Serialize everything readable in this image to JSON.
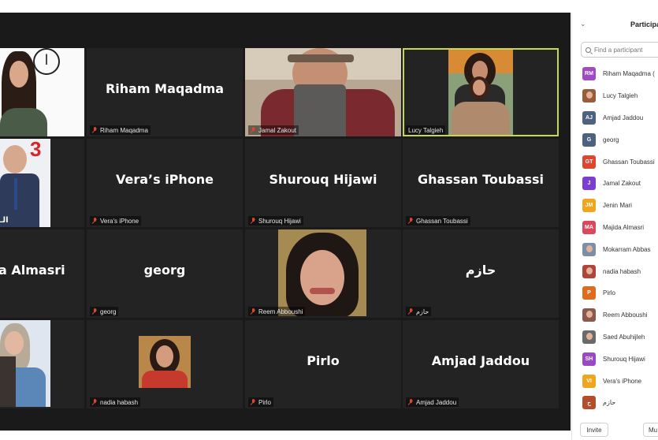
{
  "video_tiles": [
    {
      "name": "",
      "label": "",
      "type": "photo"
    },
    {
      "name": "Riham Maqadma",
      "label": "Riham Maqadma",
      "type": "name"
    },
    {
      "name": "",
      "label": "Jamal Zakout",
      "type": "photo"
    },
    {
      "name": "",
      "label": "Lucy Talgieh",
      "type": "photo",
      "active": true
    },
    {
      "name": "",
      "label": "",
      "type": "photo"
    },
    {
      "name": "Vera’s iPhone",
      "label": "Vera's iPhone",
      "type": "name"
    },
    {
      "name": "Shurouq Hijawi",
      "label": "Shurouq Hijawi",
      "type": "name"
    },
    {
      "name": "Ghassan Toubassi",
      "label": "Ghassan Toubassi",
      "type": "name"
    },
    {
      "name": "a Almasri",
      "label": "",
      "type": "name"
    },
    {
      "name": "georg",
      "label": "georg",
      "type": "name"
    },
    {
      "name": "",
      "label": "Reem Abboushi",
      "type": "photo"
    },
    {
      "name": "حازم",
      "label": "حازم",
      "type": "name"
    },
    {
      "name": "",
      "label": "",
      "type": "photo"
    },
    {
      "name": "",
      "label": "nadia habash",
      "type": "photo"
    },
    {
      "name": "Pirlo",
      "label": "Pirlo",
      "type": "name"
    },
    {
      "name": "Amjad  Jaddou",
      "label": "Amjad  Jaddou",
      "type": "name"
    }
  ],
  "tile_badges": {
    "circle_glyph": "ا",
    "red_numeral": "3",
    "arabic_strip": "الـ"
  },
  "panel": {
    "title": "Participa",
    "collapse_icon": "chevron-down-icon",
    "search_placeholder": "Find a participant",
    "invite_label": "Invite",
    "mute_label": "Mu"
  },
  "participants": [
    {
      "initials": "RM",
      "name": "Riham Maqadma (",
      "color": "#a24ac4"
    },
    {
      "initials": "",
      "name": "Lucy Talgieh",
      "color": "#9a5b3a",
      "photo": true
    },
    {
      "initials": "AJ",
      "name": "Amjad  Jaddou",
      "color": "#4d6180"
    },
    {
      "initials": "G",
      "name": "georg",
      "color": "#4d6180"
    },
    {
      "initials": "GT",
      "name": "Ghassan Toubassi",
      "color": "#e0452f"
    },
    {
      "initials": "J",
      "name": "Jamal Zakout",
      "color": "#7a3fd0"
    },
    {
      "initials": "JM",
      "name": "Jenin Mari",
      "color": "#f0a51d"
    },
    {
      "initials": "MA",
      "name": "Majida Almasri",
      "color": "#d9485f"
    },
    {
      "initials": "",
      "name": "Mokarram Abbas",
      "color": "#7c8fa6",
      "photo": true
    },
    {
      "initials": "",
      "name": "nadia habash",
      "color": "#b0443a",
      "photo": true
    },
    {
      "initials": "P",
      "name": "Pirlo",
      "color": "#e06a1d"
    },
    {
      "initials": "",
      "name": "Reem Abboushi",
      "color": "#8b5a4a",
      "photo": true
    },
    {
      "initials": "",
      "name": "Saed Abuhijleh",
      "color": "#6a6a6a",
      "photo": true
    },
    {
      "initials": "SH",
      "name": "Shurouq Hijawi",
      "color": "#9a47c8"
    },
    {
      "initials": "VI",
      "name": "Vera's iPhone",
      "color": "#f0a51d"
    },
    {
      "initials": "ح",
      "name": "حازم",
      "color": "#b44e2a"
    }
  ]
}
